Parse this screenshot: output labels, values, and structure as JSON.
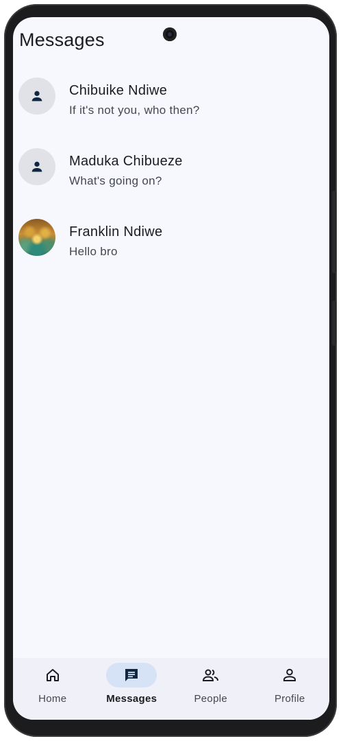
{
  "header": {
    "title": "Messages"
  },
  "conversations": [
    {
      "name": "Chibuike Ndiwe",
      "preview": "If it's not you, who then?",
      "avatar": "person-icon"
    },
    {
      "name": "Maduka Chibueze",
      "preview": "What's going on?",
      "avatar": "person-icon"
    },
    {
      "name": "Franklin Ndiwe",
      "preview": "Hello bro",
      "avatar": "photo"
    }
  ],
  "bottom_nav": {
    "active": "Messages",
    "items": [
      {
        "label": "Home",
        "icon": "home-icon"
      },
      {
        "label": "Messages",
        "icon": "chat-icon"
      },
      {
        "label": "People",
        "icon": "people-icon"
      },
      {
        "label": "Profile",
        "icon": "profile-icon"
      }
    ]
  },
  "colors": {
    "background": "#f7f8fd",
    "nav_background": "#f0f1f8",
    "active_pill": "#d6e3f7",
    "avatar_bg": "#e1e2e8",
    "icon_dark": "#0f2740"
  }
}
